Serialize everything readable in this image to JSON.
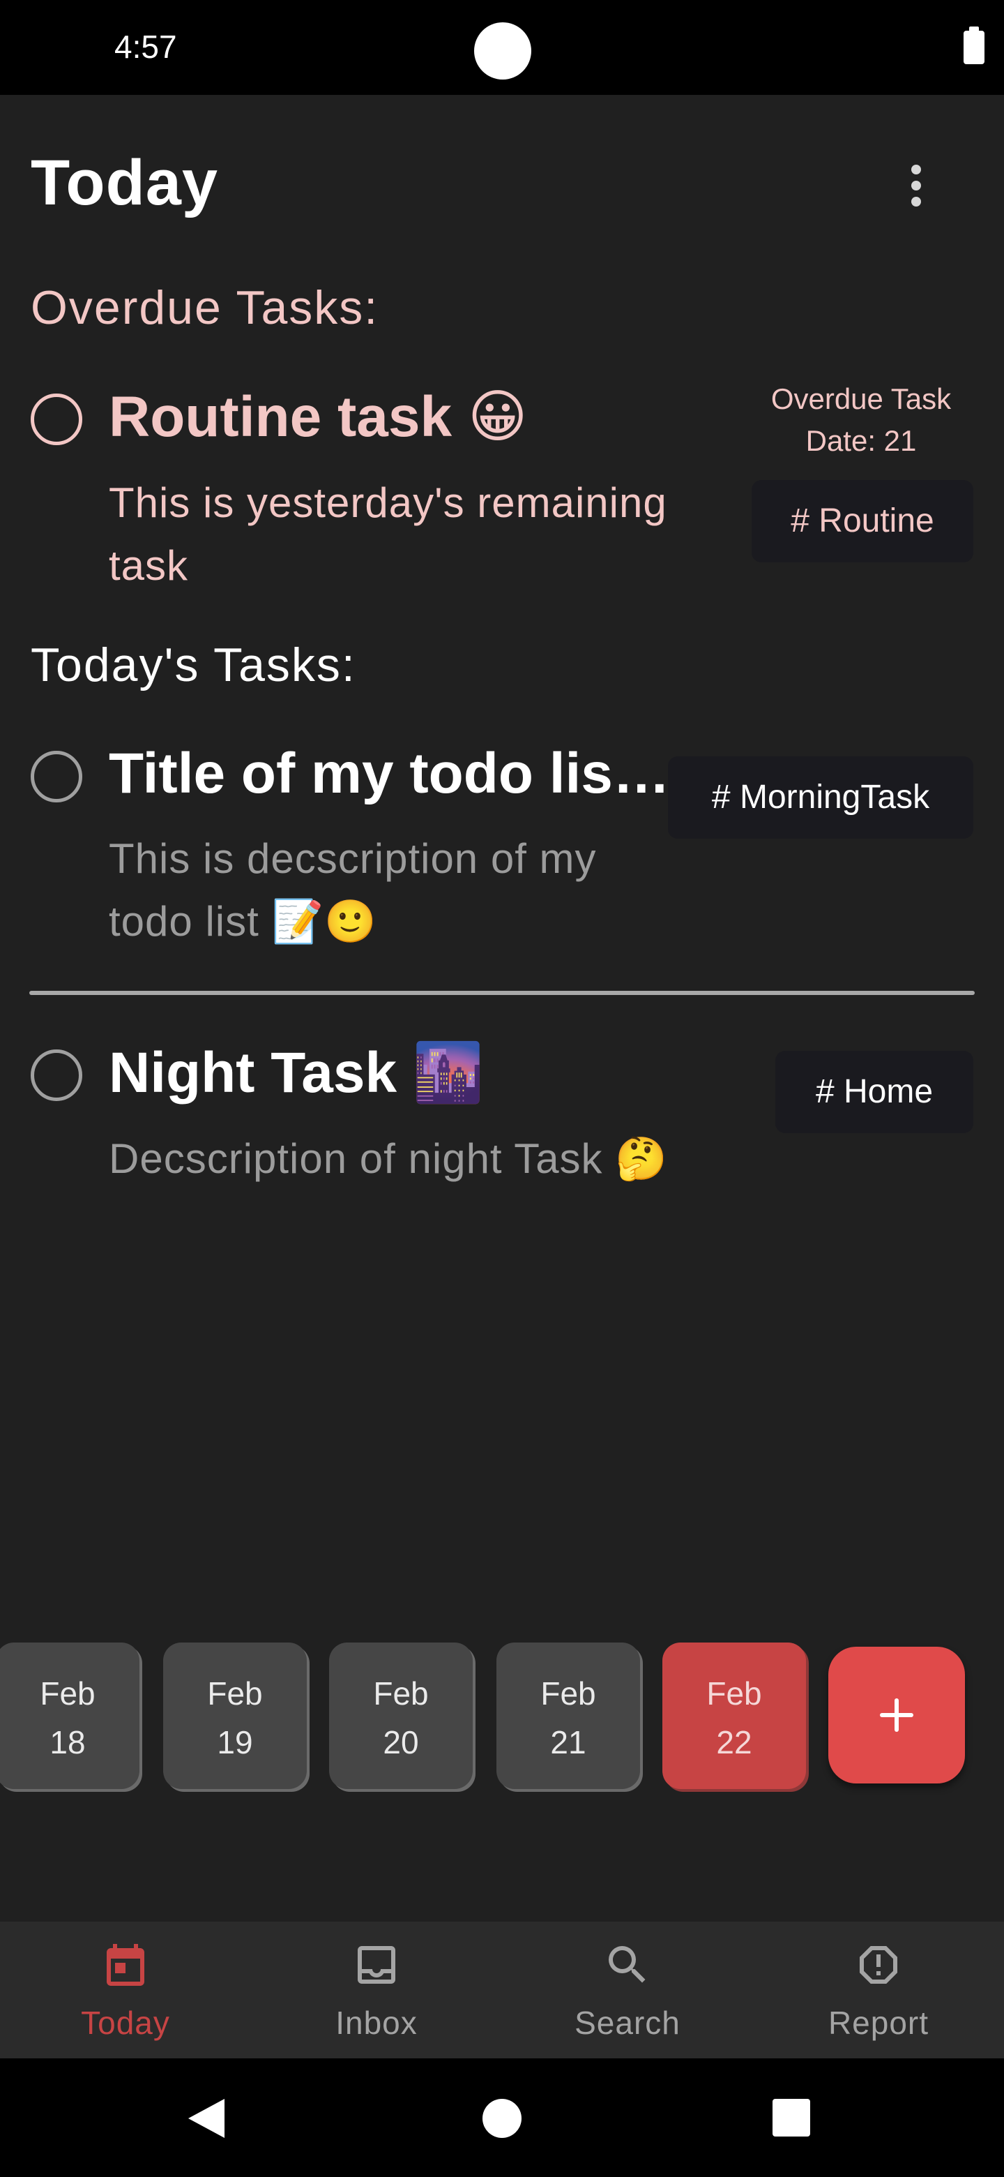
{
  "status_bar": {
    "time": "4:57"
  },
  "header": {
    "title": "Today",
    "menu_icon": "more-vert-icon"
  },
  "overdue_section": {
    "label": "Overdue Tasks:",
    "tasks": [
      {
        "title": "Routine task 😀",
        "description": "This is yesterday's remaining task",
        "overdue_line1": "Overdue Task",
        "overdue_line2": "Date: 21",
        "tag": "# Routine"
      }
    ]
  },
  "today_section": {
    "label": "Today's Tasks:",
    "tasks": [
      {
        "title": "Title of my todo lis…",
        "description": "This is decscription of my todo list 📝🙂",
        "tag": "# MorningTask"
      },
      {
        "title": "Night Task 🌆",
        "description": "Decscription of night Task 🤔",
        "tag": "# Home"
      }
    ]
  },
  "date_strip": {
    "dates": [
      {
        "month": "Feb",
        "day": "18"
      },
      {
        "month": "Feb",
        "day": "19"
      },
      {
        "month": "Feb",
        "day": "20"
      },
      {
        "month": "Feb",
        "day": "21"
      },
      {
        "month": "Feb",
        "day": "22",
        "selected": true
      }
    ],
    "add_icon": "plus-icon"
  },
  "bottom_nav": {
    "items": [
      {
        "label": "Today",
        "icon": "calendar-icon",
        "active": true
      },
      {
        "label": "Inbox",
        "icon": "inbox-icon"
      },
      {
        "label": "Search",
        "icon": "search-icon"
      },
      {
        "label": "Report",
        "icon": "report-icon"
      }
    ]
  },
  "colors": {
    "background": "#202020",
    "accent": "#e04a4a",
    "overdue_text": "#f3c7c5",
    "selected_date": "#c74444"
  }
}
